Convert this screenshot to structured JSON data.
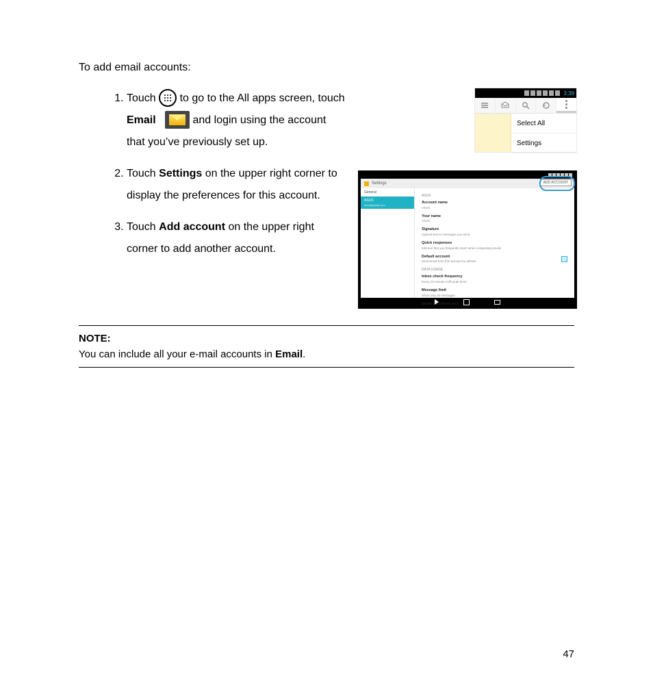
{
  "page_number": "47",
  "intro": "To add email accounts:",
  "steps": [
    {
      "pre": "Touch ",
      "icon1": "apps-circle-icon",
      "mid1": " to go to the All apps screen, touch ",
      "bold1": "Email",
      "icon2": "email-envelope-icon",
      "mid2": " and login using the account that you’ve previously set up."
    },
    {
      "pre": "Touch ",
      "bold1": "Settings",
      "mid1": " on the upper right corner to display the preferences for this account."
    },
    {
      "pre": "Touch ",
      "bold1": "Add account",
      "mid1": " on the upper right corner to add another account."
    }
  ],
  "note": {
    "title": "NOTE:",
    "body_pre": "You can include all your e-mail accounts in ",
    "body_bold": "Email",
    "body_post": "."
  },
  "mock1": {
    "time": "3:39",
    "menu_items": [
      "Select All",
      "Settings"
    ]
  },
  "mock2": {
    "header": "Settings",
    "add_btn": "ADD ACCOUNT",
    "side": {
      "general": "General",
      "account": "ASUS",
      "account_sub": "asus@gmail.com"
    },
    "main_header": "ASUS",
    "rows": [
      {
        "title": "Account name",
        "sub": "ASUS"
      },
      {
        "title": "Your name",
        "sub": "ASUS"
      },
      {
        "title": "Signature",
        "sub": "Append text to messages you send"
      },
      {
        "title": "Quick responses",
        "sub": "Edit text that you frequently insert when composing emails"
      },
      {
        "title": "Default account",
        "sub": "Send email from this account by default",
        "chk": "1"
      }
    ],
    "data_usage": "DATA USAGE",
    "rows2": [
      {
        "title": "Inbox check frequency",
        "sub": "Every 15 minutes (Off peak time)"
      },
      {
        "title": "Message limit",
        "sub": "Show only 25 messages"
      },
      {
        "title": "Email download size",
        "sub": ""
      }
    ]
  }
}
